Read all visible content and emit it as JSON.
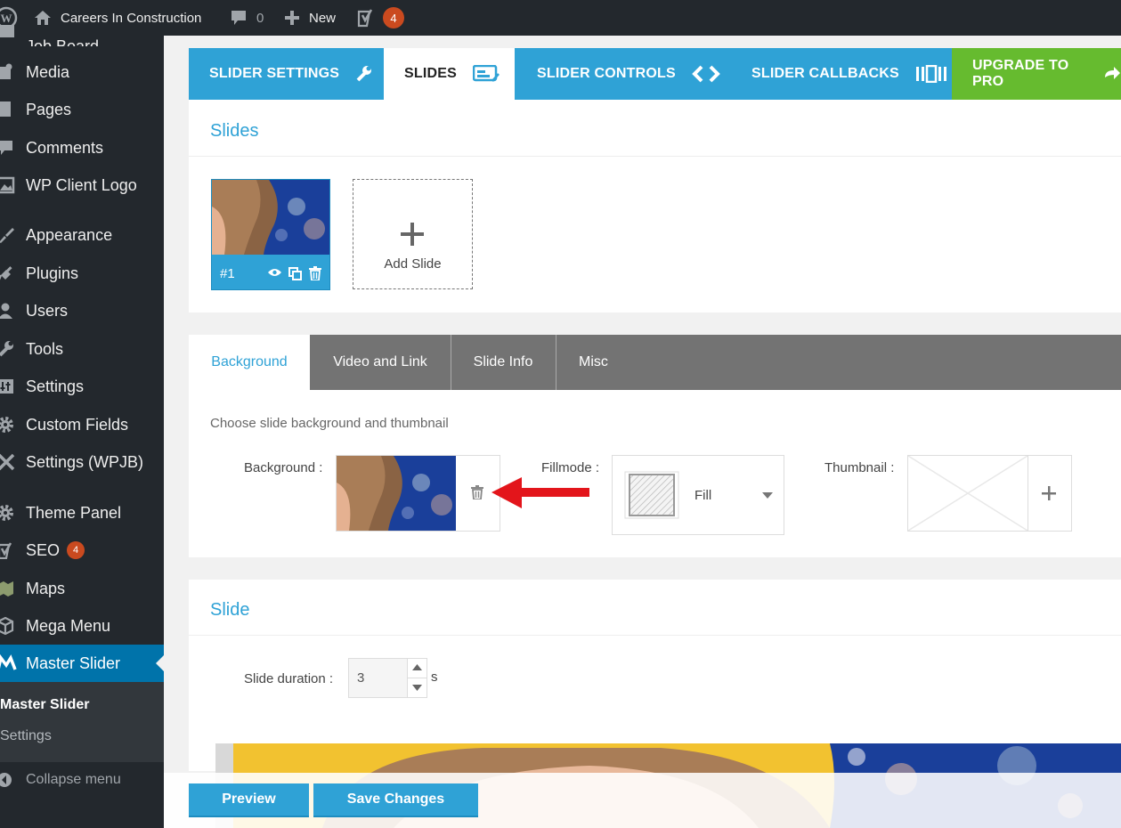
{
  "adminbar": {
    "site_name": "Careers In Construction",
    "comments_count": "0",
    "new_label": "New",
    "yoast_count": "4"
  },
  "sidebar": {
    "cut_item": "Job Board",
    "items": [
      {
        "label": "Media",
        "icon": "media-icon"
      },
      {
        "label": "Pages",
        "icon": "pages-icon"
      },
      {
        "label": "Comments",
        "icon": "comments-icon"
      },
      {
        "label": "WP Client Logo",
        "icon": "image-icon"
      },
      {
        "label": "Appearance",
        "icon": "brush-icon"
      },
      {
        "label": "Plugins",
        "icon": "plugin-icon"
      },
      {
        "label": "Users",
        "icon": "users-icon"
      },
      {
        "label": "Tools",
        "icon": "wrench-icon"
      },
      {
        "label": "Settings",
        "icon": "settings-icon"
      },
      {
        "label": "Custom Fields",
        "icon": "gear-icon"
      },
      {
        "label": "Settings (WPJB)",
        "icon": "tools-icon"
      },
      {
        "label": "Theme Panel",
        "icon": "gear-icon"
      },
      {
        "label": "SEO",
        "icon": "yoast-icon",
        "badge": "4"
      },
      {
        "label": "Maps",
        "icon": "map-icon"
      },
      {
        "label": "Mega Menu",
        "icon": "cube-icon"
      },
      {
        "label": "Master Slider",
        "icon": "master-slider-icon"
      }
    ],
    "submenu": [
      "Master Slider",
      "Settings"
    ],
    "collapse_label": "Collapse menu"
  },
  "main_tabs": [
    {
      "label": "SLIDER SETTINGS",
      "icon": "wrench-icon"
    },
    {
      "label": "SLIDES",
      "icon": "slides-icon"
    },
    {
      "label": "SLIDER CONTROLS",
      "icon": "chevrons-icon"
    },
    {
      "label": "SLIDER CALLBACKS",
      "icon": "callbacks-icon"
    },
    {
      "label": "UPGRADE TO PRO",
      "icon": "arrow-icon"
    }
  ],
  "slides_panel": {
    "title": "Slides",
    "slide_number": "#1",
    "add_slide_label": "Add Slide"
  },
  "sub_tabs": [
    "Background",
    "Video and Link",
    "Slide Info",
    "Misc"
  ],
  "background_panel": {
    "description": "Choose slide background and thumbnail",
    "background_label": "Background :",
    "fillmode_label": "Fillmode :",
    "fillmode_value": "Fill",
    "thumbnail_label": "Thumbnail :"
  },
  "slide_panel": {
    "title": "Slide",
    "duration_label": "Slide duration :",
    "duration_value": "3",
    "duration_unit": "s"
  },
  "buttons": {
    "preview": "Preview",
    "save": "Save Changes"
  },
  "colors": {
    "accent": "#2fa2d6",
    "upgrade": "#66bb2f",
    "admin_dark": "#23282d",
    "current_menu": "#0073aa",
    "badge": "#ca4a1f",
    "arrow": "#e3151b"
  }
}
